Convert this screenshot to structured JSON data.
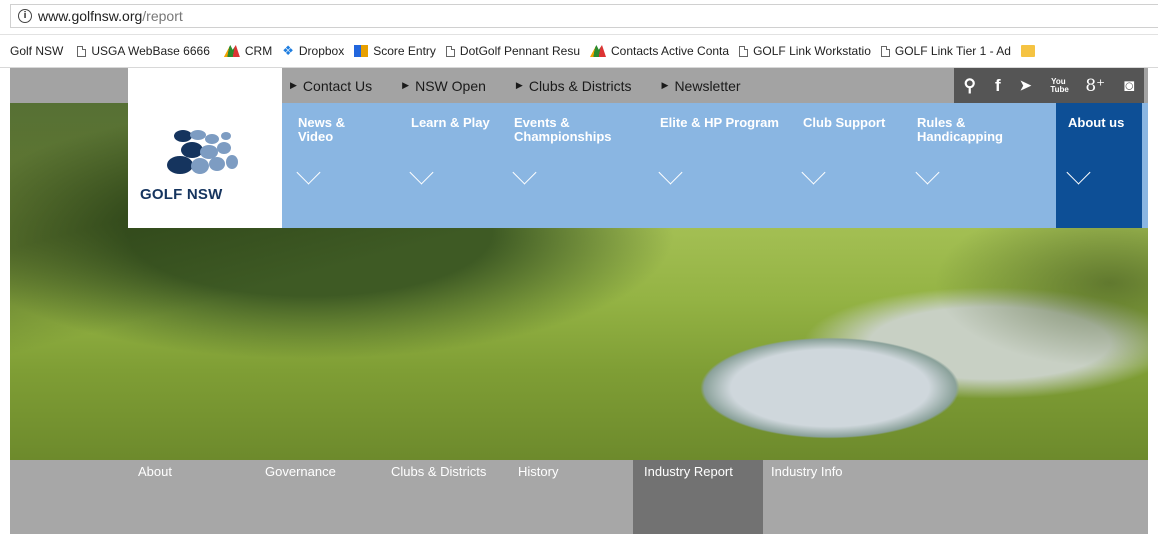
{
  "browser": {
    "url_host": "www.golfnsw.org",
    "url_path": "/report"
  },
  "bookmarks": [
    {
      "label": "Golf NSW",
      "icon": "none"
    },
    {
      "label": "USGA WebBase 6666",
      "icon": "page-icon"
    },
    {
      "label": "CRM",
      "icon": "crm-icon"
    },
    {
      "label": "Dropbox",
      "icon": "dropbox-icon"
    },
    {
      "label": "Score Entry",
      "icon": "score-icon"
    },
    {
      "label": "DotGolf Pennant Resu",
      "icon": "page-icon"
    },
    {
      "label": "Contacts Active Conta",
      "icon": "crm-icon"
    },
    {
      "label": "GOLF Link Workstatio",
      "icon": "page-icon"
    },
    {
      "label": "GOLF Link Tier 1 - Ad",
      "icon": "page-icon"
    }
  ],
  "utility_nav": [
    "Contact Us",
    "NSW Open",
    "Clubs & Districts",
    "Newsletter"
  ],
  "social": {
    "search": "⚲",
    "facebook": "f",
    "twitter": "🐦",
    "youtube": "You Tube",
    "googleplus": "8⁺",
    "instagram": "◙"
  },
  "logo": {
    "text": "GOLF NSW"
  },
  "main_nav": [
    {
      "line1": "News &",
      "line2": "Video"
    },
    {
      "line1": "Learn & Play",
      "line2": ""
    },
    {
      "line1": "Events &",
      "line2": "Championships"
    },
    {
      "line1": "Elite & HP Program",
      "line2": ""
    },
    {
      "line1": "Club Support",
      "line2": ""
    },
    {
      "line1": "Rules &",
      "line2": "Handicapping"
    },
    {
      "line1": "About us",
      "line2": ""
    }
  ],
  "sub_nav": [
    "About",
    "Governance",
    "Clubs & Districts",
    "History",
    "Industry Report",
    "Industry Info"
  ],
  "sub_nav_active": "Industry Report",
  "colors": {
    "main_nav_bg": "#8ab6e2",
    "about_active_bg": "#0d4f96",
    "logo_blue": "#15345e"
  }
}
